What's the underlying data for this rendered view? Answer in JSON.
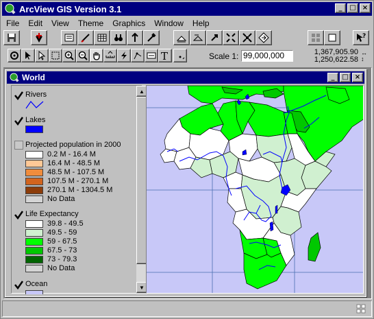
{
  "app": {
    "title": "ArcView GIS Version 3.1"
  },
  "menu": [
    "File",
    "Edit",
    "View",
    "Theme",
    "Graphics",
    "Window",
    "Help"
  ],
  "scale": {
    "label": "Scale 1:",
    "value": "99,000,000"
  },
  "coords": {
    "x": "1,367,905.90",
    "y": "1,250,622.58"
  },
  "view": {
    "title": "World"
  },
  "legend": {
    "rivers": {
      "label": "Rivers",
      "checked": true
    },
    "lakes": {
      "label": "Lakes",
      "checked": true,
      "color": "#0000ff"
    },
    "population": {
      "label": "Projected population in 2000",
      "checked": false,
      "classes": [
        {
          "label": "0.2 M - 16.4 M",
          "color": "#ffffff"
        },
        {
          "label": "16.4 M - 48.5 M",
          "color": "#ffc896"
        },
        {
          "label": "48.5 M - 107.5 M",
          "color": "#f08c3c"
        },
        {
          "label": "107.5 M - 270.1 M",
          "color": "#d2641e"
        },
        {
          "label": "270.1 M - 1304.5 M",
          "color": "#8c3c0a"
        },
        {
          "label": "No Data",
          "color": "#d4d4d4"
        }
      ]
    },
    "life": {
      "label": "Life Expectancy",
      "checked": true,
      "classes": [
        {
          "label": "39.8 - 49.5",
          "color": "#ffffff"
        },
        {
          "label": "49.5 - 59",
          "color": "#d0f0d0"
        },
        {
          "label": "59 - 67.5",
          "color": "#00ff00"
        },
        {
          "label": "67.5 - 73",
          "color": "#00c800"
        },
        {
          "label": "73 - 79.3",
          "color": "#006400"
        },
        {
          "label": "No Data",
          "color": "#d4d4d4"
        }
      ]
    },
    "ocean": {
      "label": "Ocean",
      "checked": true
    }
  },
  "colors": {
    "titlebar": "#000080",
    "ocean": "#c8c8f8",
    "river": "#0000ff"
  }
}
